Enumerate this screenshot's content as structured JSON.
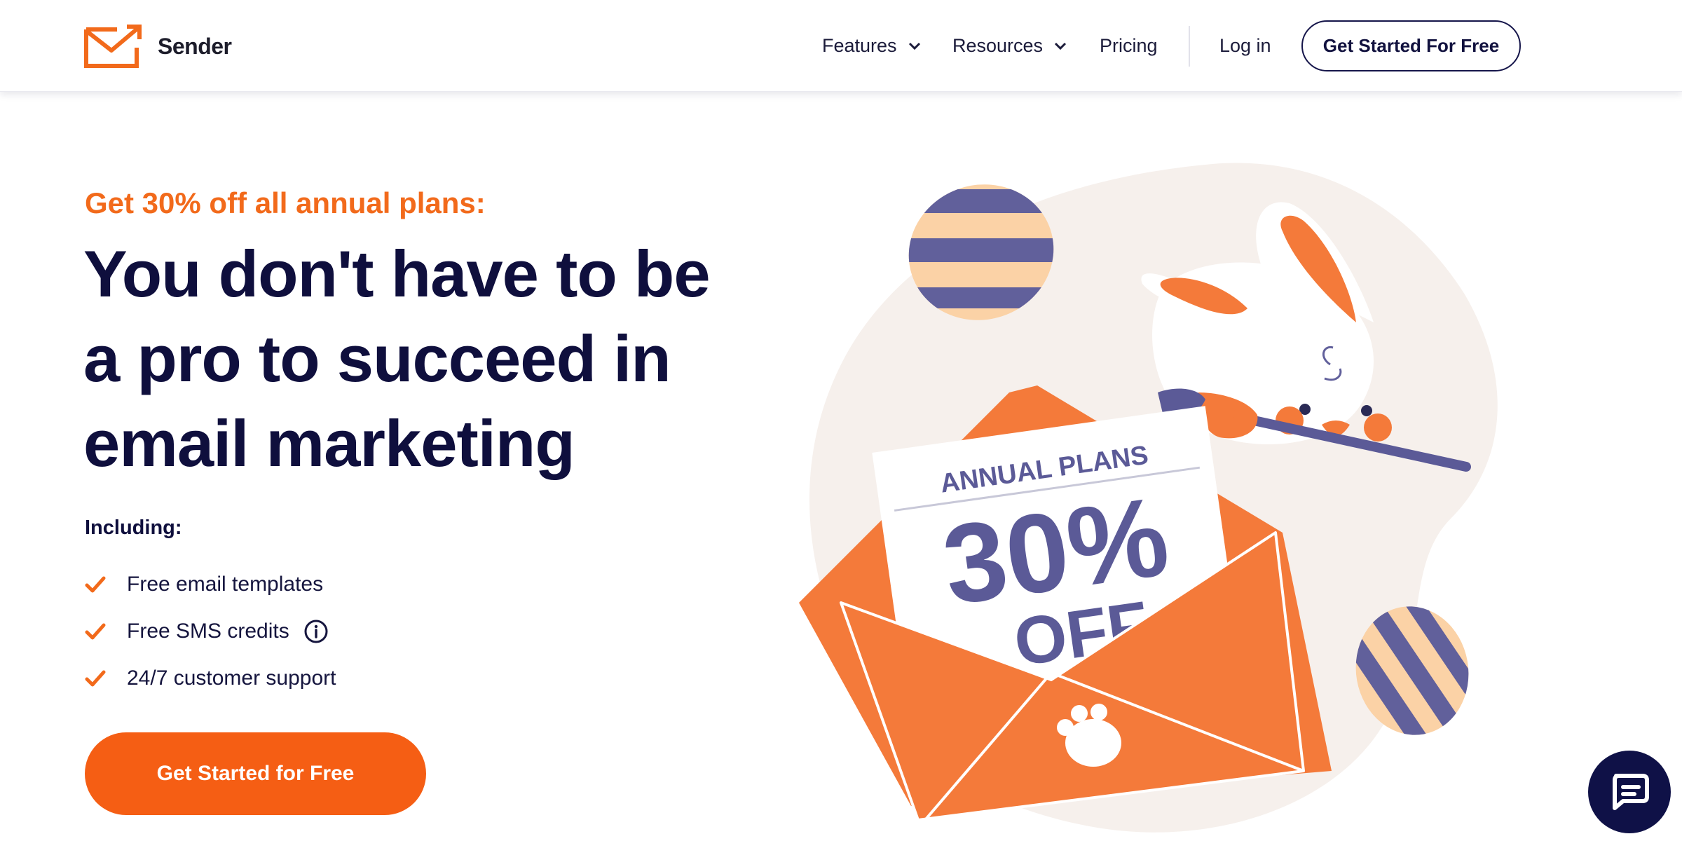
{
  "brand": {
    "name": "Sender",
    "logo_icon": "envelope-arrow-icon",
    "accent": "#f26a1b",
    "navy": "#0f0f3d"
  },
  "nav": {
    "features": "Features",
    "resources": "Resources",
    "pricing": "Pricing",
    "login": "Log in",
    "cta": "Get Started For Free"
  },
  "hero": {
    "promo": "Get 30% off all annual plans:",
    "headline_lines": [
      "You don't have to be",
      "a pro to succeed in",
      "email marketing"
    ],
    "including": "Including:",
    "features": [
      "Free email templates",
      "Free SMS credits",
      "24/7 customer support"
    ],
    "cta": "Get Started for Free"
  },
  "illustration": {
    "label": "ANNUAL PLANS",
    "percent": "30%",
    "off": "OFF"
  },
  "chat": {
    "icon": "chat-bubble-icon"
  }
}
